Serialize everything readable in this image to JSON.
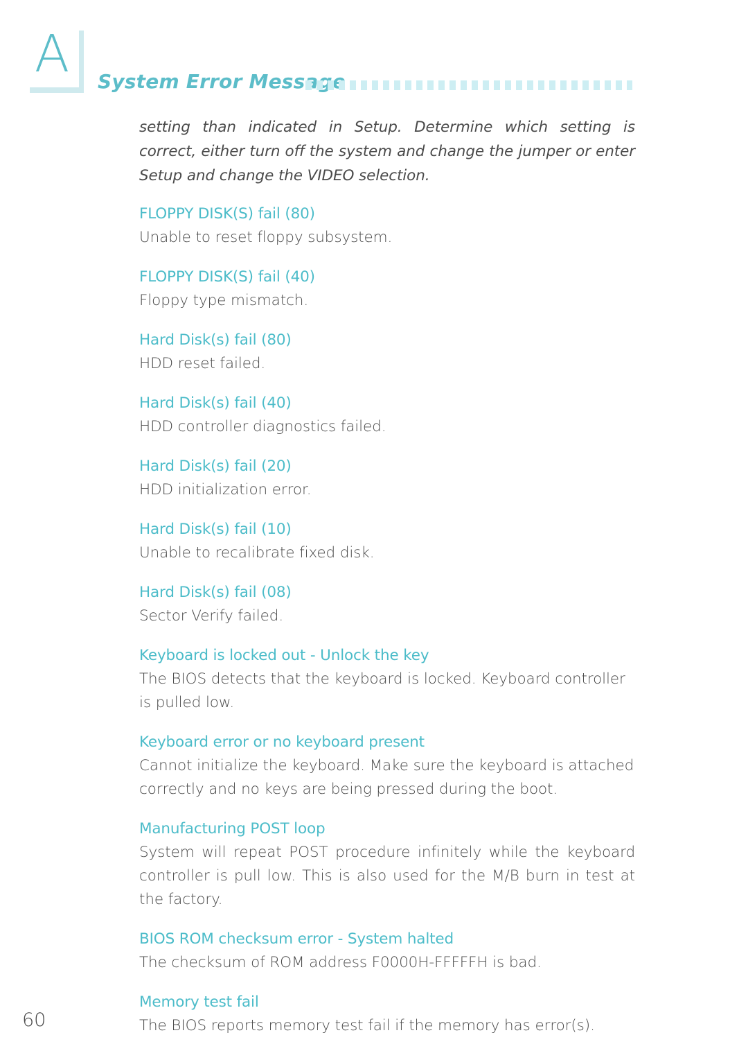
{
  "header": {
    "appendix_letter": "A",
    "title": "System Error Message",
    "dots_icon": "dotted-rule",
    "accent_color": "#4cbcc9",
    "dot_color": "#cdeef3"
  },
  "content": {
    "intro_paragraph": "setting than indicated in Setup. Determine which setting is correct, either turn off the system and change the jumper or enter Setup and change the VIDEO selection.",
    "entries": [
      {
        "title": "FLOPPY DISK(S) fail (80)",
        "body": "Unable to reset floppy subsystem."
      },
      {
        "title": "FLOPPY DISK(S) fail (40)",
        "body": "Floppy type mismatch."
      },
      {
        "title": "Hard Disk(s) fail (80)",
        "body": "HDD reset failed."
      },
      {
        "title": "Hard Disk(s) fail (40)",
        "body": "HDD controller diagnostics failed."
      },
      {
        "title": "Hard Disk(s) fail (20)",
        "body": "HDD initialization error."
      },
      {
        "title": "Hard Disk(s) fail (10)",
        "body": "Unable to recalibrate fixed disk."
      },
      {
        "title": "Hard Disk(s) fail (08)",
        "body": "Sector Verify failed."
      },
      {
        "title": "Keyboard is locked out - Unlock the key",
        "body": "The BIOS detects that the keyboard is locked. Keyboard controller is pulled low."
      },
      {
        "title": "Keyboard error or no keyboard present",
        "body": "Cannot initialize the keyboard. Make sure the keyboard is attached correctly and no keys are being pressed during the boot."
      },
      {
        "title": "Manufacturing POST loop",
        "body": "System will repeat POST procedure infinitely while the keyboard controller is pull low. This is also used for the M/B burn in test at the factory."
      },
      {
        "title": "BIOS ROM checksum error - System halted",
        "body": "The checksum of ROM address F0000H-FFFFFH is bad."
      },
      {
        "title": "Memory test fail",
        "body": "The BIOS reports memory test fail if the memory has error(s)."
      }
    ]
  },
  "footer": {
    "page_number": "60"
  }
}
